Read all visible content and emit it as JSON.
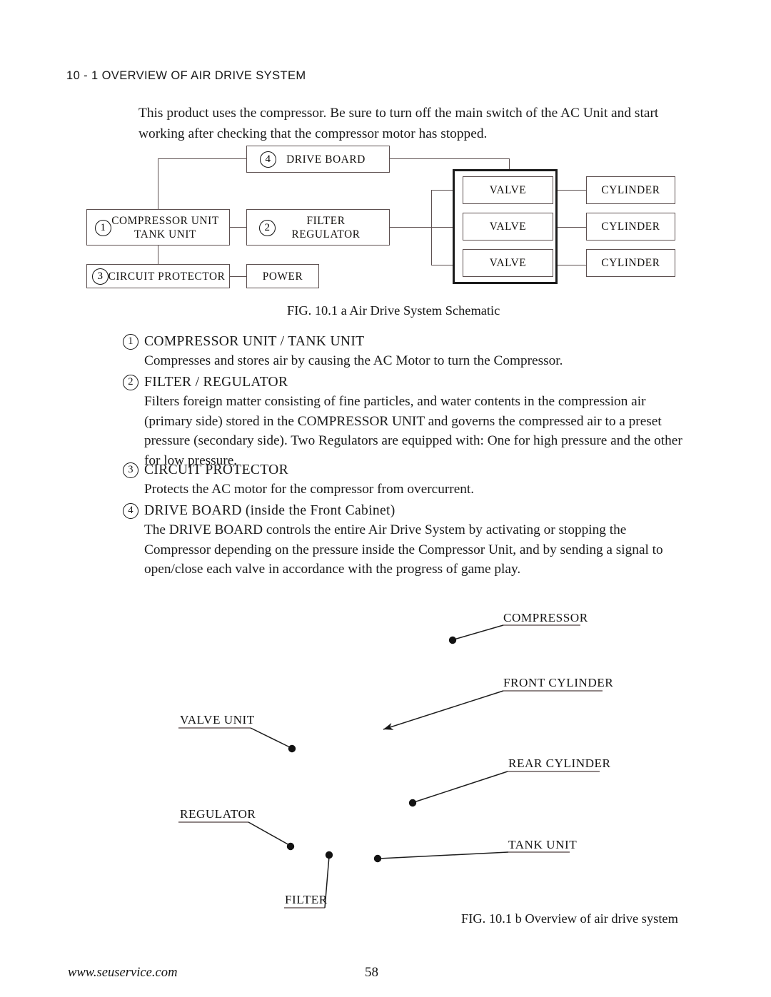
{
  "section": {
    "heading": "10 - 1  OVERVIEW OF AIR DRIVE SYSTEM",
    "intro": "This product uses the compressor. Be sure to turn off the main switch of the AC Unit and start working after checking that the compressor motor has stopped."
  },
  "schematic": {
    "caption": "FIG. 10.1 a  Air Drive System Schematic",
    "boxes": {
      "drive_board": {
        "label": "DRIVE BOARD",
        "num": "4"
      },
      "compressor_unit": {
        "line1": "COMPRESSOR UNIT",
        "line2": "TANK UNIT",
        "num": "1"
      },
      "filter_regulator": {
        "line1": "FILTER",
        "line2": "REGULATOR",
        "num": "2"
      },
      "circuit_protector": {
        "label": "CIRCUIT PROTECTOR",
        "num": "3"
      },
      "power": {
        "label": "POWER"
      },
      "valve_1": {
        "label": "VALVE"
      },
      "valve_2": {
        "label": "VALVE"
      },
      "valve_3": {
        "label": "VALVE"
      },
      "cylinder_1": {
        "label": "CYLINDER"
      },
      "cylinder_2": {
        "label": "CYLINDER"
      },
      "cylinder_3": {
        "label": "CYLINDER"
      }
    }
  },
  "descriptions": [
    {
      "num": "1",
      "title": "COMPRESSOR UNIT / TANK UNIT",
      "body": "Compresses and stores air by causing the AC Motor to turn the Compressor."
    },
    {
      "num": "2",
      "title": "FILTER / REGULATOR",
      "body": "Filters foreign matter consisting of fine particles, and water contents in the compression air (primary side) stored in the COMPRESSOR UNIT and governs the compressed air to a preset pressure (secondary side).  Two Regulators are equipped with: One for high pressure and the other for low pressure."
    },
    {
      "num": "3",
      "title": "CIRCUIT PROTECTOR",
      "body": "Protects the AC motor for the compressor from overcurrent."
    },
    {
      "num": "4",
      "title": "DRIVE BOARD (inside the Front Cabinet)",
      "body": "The DRIVE BOARD controls the entire Air Drive System by activating or stopping the Compressor depending on the pressure inside the Compressor Unit, and by sending a signal to open/close each valve in accordance with the progress of game play."
    }
  ],
  "overview": {
    "caption": "FIG. 10.1 b  Overview of air drive system",
    "callouts": [
      {
        "label": "COMPRESSOR"
      },
      {
        "label": "FRONT CYLINDER"
      },
      {
        "label": "VALVE UNIT"
      },
      {
        "label": "REAR CYLINDER"
      },
      {
        "label": "REGULATOR"
      },
      {
        "label": "TANK UNIT"
      },
      {
        "label": "FILTER"
      }
    ]
  },
  "footer": {
    "url": "www.seuservice.com",
    "page": "58"
  }
}
